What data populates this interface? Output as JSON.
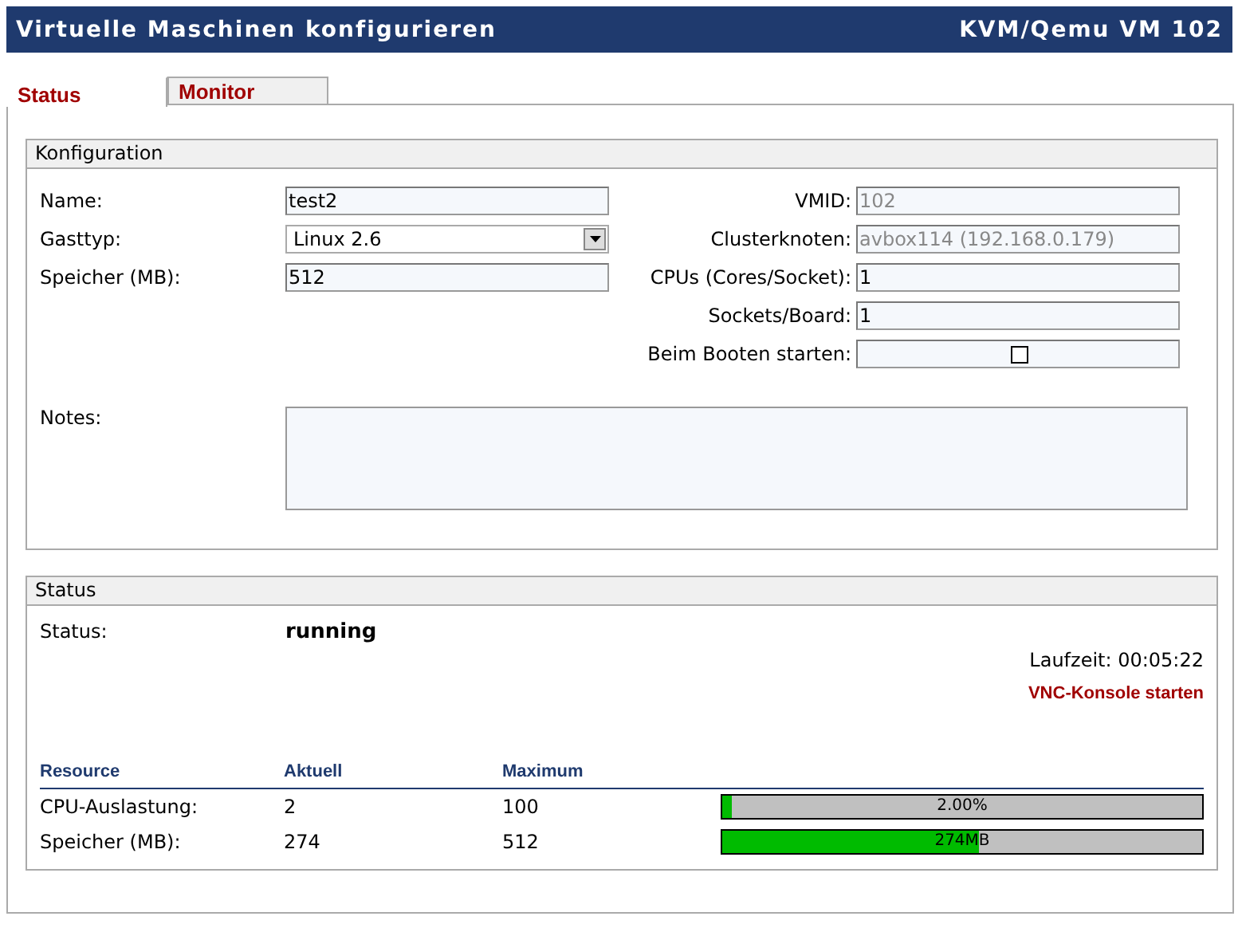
{
  "window": {
    "title": "Virtuelle Maschinen konfigurieren",
    "subtitle": "KVM/Qemu VM 102"
  },
  "tabs": [
    {
      "label": "Status",
      "selected": true
    },
    {
      "label": "Monitor",
      "selected": false
    }
  ],
  "config": {
    "title": "Konfiguration",
    "left": [
      {
        "kind": "text",
        "label": "Name:",
        "value": "test2",
        "disabled": false
      },
      {
        "kind": "select",
        "label": "Gasttyp:",
        "value": "Linux 2.6",
        "disabled": false
      },
      {
        "kind": "text",
        "label": "Speicher (MB):",
        "value": "512",
        "disabled": false
      }
    ],
    "right": [
      {
        "kind": "text",
        "label": "VMID:",
        "value": "102",
        "disabled": true
      },
      {
        "kind": "text",
        "label": "Clusterknoten:",
        "value": "avbox114 (192.168.0.179)",
        "disabled": true
      },
      {
        "kind": "text",
        "label": "CPUs (Cores/Socket):",
        "value": "1",
        "disabled": false
      },
      {
        "kind": "text",
        "label": "Sockets/Board:",
        "value": "1",
        "disabled": false
      },
      {
        "kind": "checkbox",
        "label": "Beim Booten starten:",
        "checked": false
      }
    ],
    "notes": {
      "label": "Notes:"
    }
  },
  "status": {
    "title": "Status",
    "label": "Status:",
    "value": "running",
    "uptime": "Laufzeit: 00:05:22",
    "vnc_link": "VNC-Konsole starten",
    "columns": [
      "Resource",
      "Aktuell",
      "Maximum"
    ],
    "rows": [
      {
        "name": "CPU-Auslastung:",
        "current": "2",
        "maximum": "100",
        "level": 0.02,
        "bar_text": "2.00%"
      },
      {
        "name": "Speicher (MB):",
        "current": "274",
        "maximum": "512",
        "level": 0.535,
        "bar_text": "274MB"
      }
    ]
  }
}
